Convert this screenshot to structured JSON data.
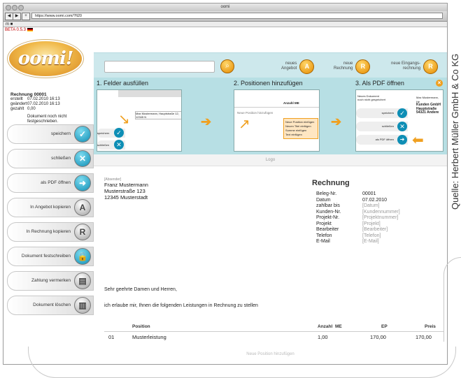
{
  "browser": {
    "window_title": "oomi",
    "url": "https://www.oomi.com/?fi20",
    "bookmarks": "m ■"
  },
  "beta_label": "BETA 0.5.3",
  "logo_text": "oomi!",
  "document_info": {
    "title": "Rechnung 00001",
    "rows": [
      {
        "k": "erstellt",
        "v": "07.02.2010 16:13"
      },
      {
        "k": "geändert",
        "v": "07.02.2010 16:13"
      },
      {
        "k": "gezahlt",
        "v": "0,00"
      }
    ],
    "note_line1": "Dokument noch nicht",
    "note_line2": "festgeschrieben."
  },
  "actions": [
    {
      "label": "speichern",
      "icon": "check-icon",
      "glyph": "✓",
      "style": "teal"
    },
    {
      "label": "schließen",
      "icon": "close-icon",
      "glyph": "✕",
      "style": "teal"
    },
    {
      "label": "als PDF öffnen",
      "icon": "pdf-icon",
      "glyph": "➜",
      "style": "teal"
    },
    {
      "label": "In Angebot kopieren",
      "icon": "copy-offer-icon",
      "glyph": "A",
      "style": "gray"
    },
    {
      "label": "In Rechnung kopieren",
      "icon": "copy-invoice-icon",
      "glyph": "R",
      "style": "gray"
    },
    {
      "label": "Dokument festschreiben",
      "icon": "lock-icon",
      "glyph": "🔒",
      "style": "teal"
    },
    {
      "label": "Zahlung vermerken",
      "icon": "payment-icon",
      "glyph": "▤",
      "style": "gray"
    },
    {
      "label": "Dokument löschen",
      "icon": "trash-icon",
      "glyph": "▥",
      "style": "gray"
    }
  ],
  "header": {
    "search_placeholder": "",
    "new_buttons": [
      {
        "line1": "neues",
        "line2": "Angebot",
        "glyph": "A",
        "icon": "new-offer-icon"
      },
      {
        "line1": "neue",
        "line2": "Rechnung",
        "glyph": "R",
        "icon": "new-invoice-icon"
      },
      {
        "line1": "neue Eingangs-",
        "line2": "rechnung",
        "glyph": "R",
        "icon": "new-incoming-invoice-icon"
      }
    ]
  },
  "steps": [
    {
      "title": "1. Felder ausfüllen"
    },
    {
      "title": "2. Positionen hinzufügen"
    },
    {
      "title": "3. Als PDF öffnen"
    }
  ],
  "step_shots": {
    "s1_text": "Max Mustermann, Hauptstraße 12, 12345 N",
    "s1_btn1": "speichern",
    "s1_btn2": "schließen",
    "s2_header": "Anzahl ME",
    "s2_link": "Neue Position hinzufügen",
    "s2_menu": [
      "Neue Position einfügen",
      "Neuen Titel einfügen",
      "Summe einfügen",
      "Text einfügen"
    ],
    "s3_note1": "Neues Dokument",
    "s3_note2": "noch nicht gespeichert",
    "s3_addr": [
      "Max Mustermann, He",
      "Kunden GmbH",
      "Hauptstraße",
      "54321 Andere"
    ],
    "s3_btns": [
      "speichern",
      "schließen",
      "als PDF öffnen"
    ]
  },
  "logo_bar": "Logo",
  "document": {
    "sender_label": "[Absender]",
    "address": [
      "Franz Mustermann",
      "Musterstraße 123",
      "12345 Musterstadt"
    ],
    "title": "Rechnung",
    "meta": [
      {
        "k": "Beleg-Nr.",
        "v": "00001",
        "ph": false
      },
      {
        "k": "Datum",
        "v": "07.02.2010",
        "ph": false
      },
      {
        "k": "zahlbar bis",
        "v": "[Datum]",
        "ph": true
      },
      {
        "k": "Kunden-Nr.",
        "v": "[Kundennummer]",
        "ph": true
      },
      {
        "k": "Projekt-Nr.",
        "v": "[Projektnummer]",
        "ph": true
      },
      {
        "k": "Projekt",
        "v": "[Projekt]",
        "ph": true
      },
      {
        "k": "Bearbeiter",
        "v": "[Bearbeiter]",
        "ph": true
      },
      {
        "k": "Telefon",
        "v": "[Telefon]",
        "ph": true
      },
      {
        "k": "E-Mail",
        "v": "[E-Mail]",
        "ph": true
      }
    ],
    "greeting": "Sehr geehrte Damen und Herren,",
    "intro": "ich erlaube mir, Ihnen die folgenden Leistungen in Rechnung zu stellen",
    "table_headers": {
      "position": "Position",
      "anzahl": "Anzahl",
      "me": "ME",
      "ep": "EP",
      "preis": "Preis"
    },
    "rows": [
      {
        "nr": "01",
        "position": "Musterleistung",
        "anzahl": "1,00",
        "ep": "170,00",
        "preis": "170,00"
      }
    ],
    "add_position": "Neue Position hinzufügen"
  },
  "credit": "Quelle: Herbert Müller GmbH & Co KG",
  "colors": {
    "teal_bar": "#cde8ec",
    "steps_bg": "#b7dfe4",
    "accent_orange": "#e58a00",
    "button_teal": "#0e8eb5"
  }
}
